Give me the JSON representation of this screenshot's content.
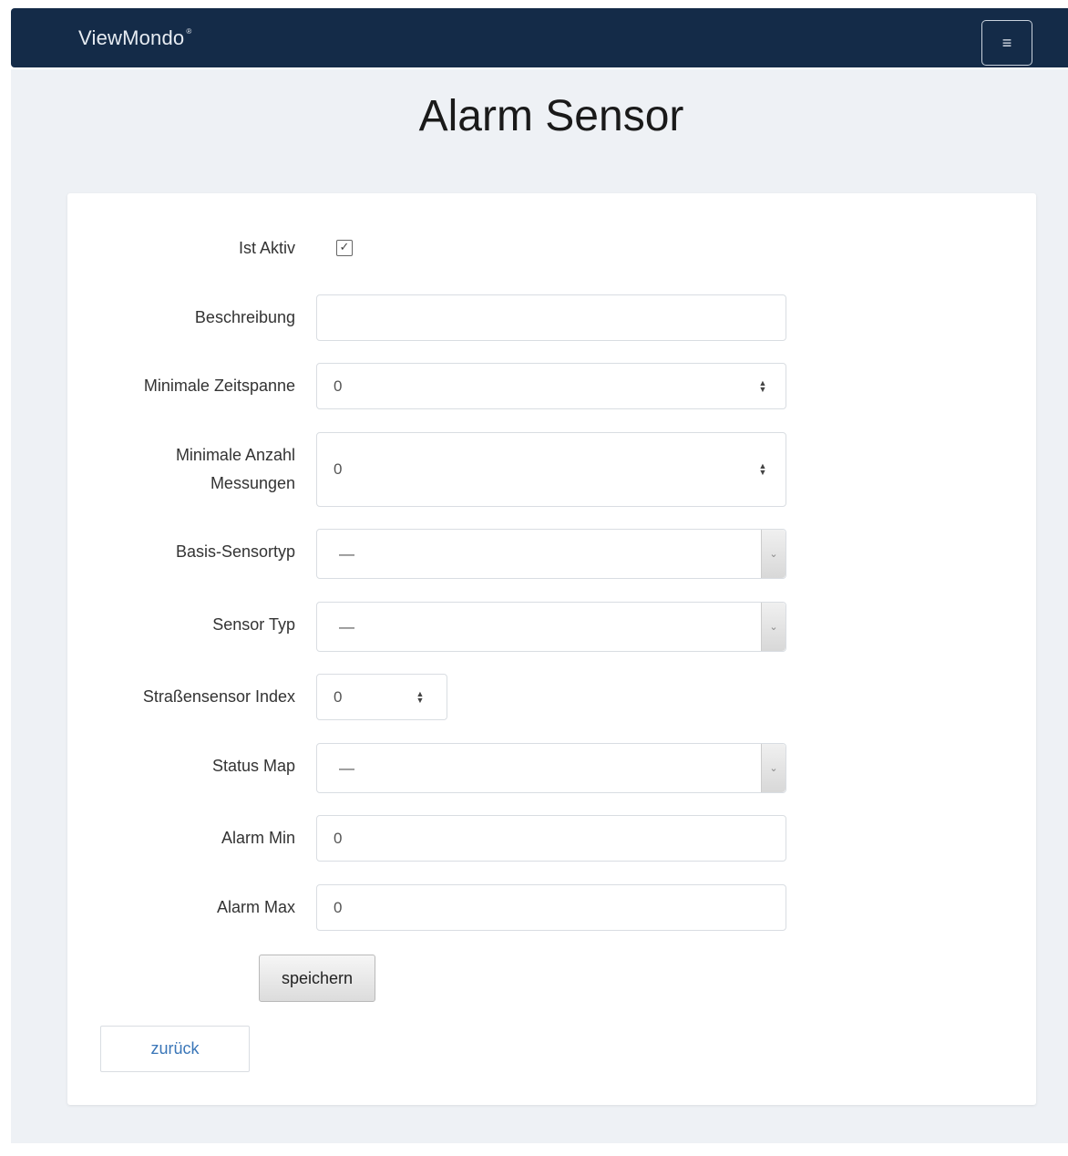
{
  "navbar": {
    "brand": "ViewMondo",
    "brand_mark": "®",
    "menu_icon": "hamburger-menu-icon"
  },
  "page": {
    "title": "Alarm Sensor"
  },
  "form": {
    "ist_aktiv": {
      "label": "Ist Aktiv",
      "checked": true
    },
    "beschreibung": {
      "label": "Beschreibung",
      "value": ""
    },
    "min_zeitspanne": {
      "label": "Minimale Zeitspanne",
      "value": "0"
    },
    "min_anzahl": {
      "label_line1": "Minimale Anzahl",
      "label_line2": "Messungen",
      "value": "0"
    },
    "basis_sensortyp": {
      "label": "Basis-Sensortyp",
      "selected": "—"
    },
    "sensor_typ": {
      "label": "Sensor Typ",
      "selected": "—"
    },
    "strassensensor_index": {
      "label": "Straßensensor Index",
      "value": "0"
    },
    "status_map": {
      "label": "Status Map",
      "selected": "—"
    },
    "alarm_min": {
      "label": "Alarm Min",
      "value": "0"
    },
    "alarm_max": {
      "label": "Alarm Max",
      "value": "0"
    }
  },
  "actions": {
    "save_label": "speichern",
    "back_label": "zurück"
  },
  "colors": {
    "navbar_bg": "#142b48",
    "page_bg": "#eef1f5",
    "link": "#3a76b8"
  }
}
